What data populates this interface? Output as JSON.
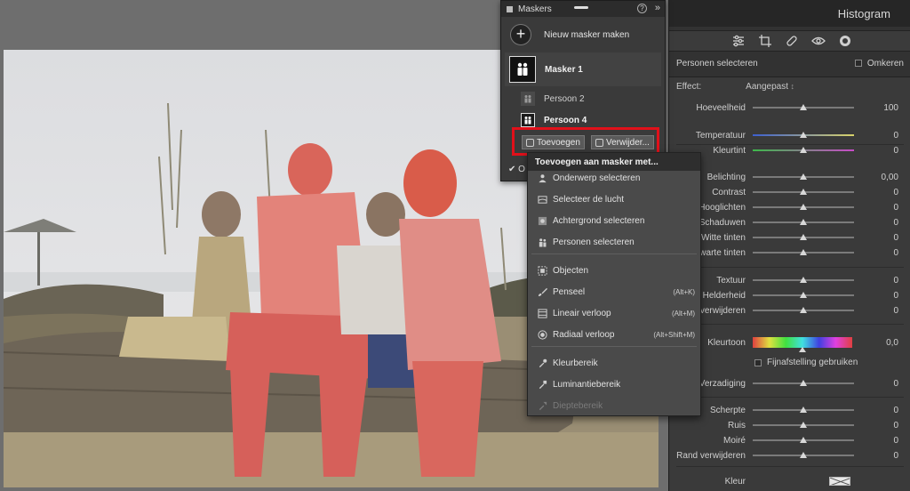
{
  "right_panel": {
    "title": "Histogram",
    "tools": [
      "sliders-icon",
      "crop-icon",
      "bandage-icon",
      "eye-icon",
      "mask-icon"
    ],
    "section_label": "Personen selecteren",
    "invert_label": "Omkeren",
    "effect_label": "Effect:",
    "effect_value": "Aangepast",
    "sliders": [
      {
        "label": "Hoeveelheid",
        "value": "100",
        "pos": 0.5,
        "track": "plain"
      },
      {
        "label": "Temperatuur",
        "value": "0",
        "pos": 0.5,
        "track": "temp"
      },
      {
        "label": "Kleurtint",
        "value": "0",
        "pos": 0.5,
        "track": "tint"
      },
      {
        "label": "Belichting",
        "value": "0,00",
        "pos": 0.5,
        "track": "plain"
      },
      {
        "label": "Contrast",
        "value": "0",
        "pos": 0.5,
        "track": "plain"
      },
      {
        "label": "Hooglichten",
        "value": "0",
        "pos": 0.5,
        "track": "plain"
      },
      {
        "label": "Schaduwen",
        "value": "0",
        "pos": 0.5,
        "track": "plain"
      },
      {
        "label": "Witte tinten",
        "value": "0",
        "pos": 0.5,
        "track": "plain"
      },
      {
        "label": "Zwarte tinten",
        "value": "0",
        "pos": 0.5,
        "track": "plain"
      },
      {
        "label": "Textuur",
        "value": "0",
        "pos": 0.5,
        "track": "plain"
      },
      {
        "label": "Helderheid",
        "value": "0",
        "pos": 0.5,
        "track": "plain"
      },
      {
        "label": "el verwijderen",
        "value": "0",
        "pos": 0.5,
        "track": "plain"
      },
      {
        "label": "Verzadiging",
        "value": "0",
        "pos": 0.5,
        "track": "plain"
      },
      {
        "label": "Scherpte",
        "value": "0",
        "pos": 0.5,
        "track": "plain"
      },
      {
        "label": "Ruis",
        "value": "0",
        "pos": 0.5,
        "track": "plain"
      },
      {
        "label": "Moiré",
        "value": "0",
        "pos": 0.5,
        "track": "plain"
      },
      {
        "label": "Rand verwijderen",
        "value": "0",
        "pos": 0.5,
        "track": "plain"
      }
    ],
    "hue": {
      "label": "Kleurtoon",
      "value": "0,0"
    },
    "fine_tune_label": "Fijnafstelling gebruiken",
    "color_label": "Kleur"
  },
  "masks_panel": {
    "title": "Maskers",
    "help": "?",
    "collapse": "»",
    "new_mask_label": "Nieuw masker maken",
    "mask_name": "Masker 1",
    "components": [
      {
        "label": "Persoon 2",
        "active": false
      },
      {
        "label": "Persoon 4",
        "active": true
      }
    ],
    "add_label": "Toevoegen",
    "remove_label": "Verwijder...",
    "ok_label": "O",
    "highlight_color": "#e1101a"
  },
  "add_menu": {
    "title": "Toevoegen aan masker met...",
    "items": [
      {
        "label": "Onderwerp selecteren",
        "icon": "person-icon",
        "shortcut": "",
        "enabled": true
      },
      {
        "label": "Selecteer de lucht",
        "icon": "sky-icon",
        "shortcut": "",
        "enabled": true
      },
      {
        "label": "Achtergrond selecteren",
        "icon": "background-icon",
        "shortcut": "",
        "enabled": true
      },
      {
        "label": "Personen selecteren",
        "icon": "people-icon",
        "shortcut": "",
        "enabled": true
      },
      {
        "label": "Objecten",
        "icon": "objects-icon",
        "shortcut": "",
        "enabled": true
      },
      {
        "label": "Penseel",
        "icon": "brush-icon",
        "shortcut": "(Alt+K)",
        "enabled": true
      },
      {
        "label": "Lineair verloop",
        "icon": "linear-gradient-icon",
        "shortcut": "(Alt+M)",
        "enabled": true
      },
      {
        "label": "Radiaal verloop",
        "icon": "radial-gradient-icon",
        "shortcut": "(Alt+Shift+M)",
        "enabled": true
      },
      {
        "label": "Kleurbereik",
        "icon": "color-range-icon",
        "shortcut": "",
        "enabled": true
      },
      {
        "label": "Luminantiebereik",
        "icon": "luminance-range-icon",
        "shortcut": "",
        "enabled": true
      },
      {
        "label": "Dieptebereik",
        "icon": "depth-range-icon",
        "shortcut": "",
        "enabled": false
      }
    ]
  }
}
